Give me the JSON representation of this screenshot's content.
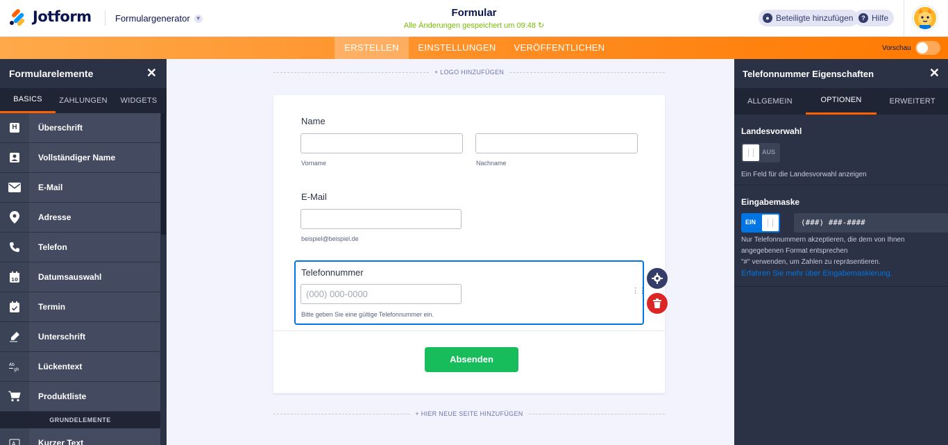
{
  "header": {
    "brand": "Jotform",
    "product": "Formulargenerator",
    "form_title": "Formular",
    "save_status": "Alle Änderungen gespeichert um 09:48",
    "invite_label": "Beteiligte hinzufügen",
    "help_label": "Hilfe"
  },
  "nav": {
    "tabs": [
      "ERSTELLEN",
      "EINSTELLUNGEN",
      "VERÖFFENTLICHEN"
    ],
    "active": 0,
    "preview_label": "Vorschau",
    "accent": "#ff7a00"
  },
  "left_panel": {
    "title": "Formularelemente",
    "tabs": [
      "BASICS",
      "ZAHLUNGEN",
      "WIDGETS"
    ],
    "items": [
      {
        "label": "Überschrift",
        "icon": "heading-icon"
      },
      {
        "label": "Vollständiger Name",
        "icon": "contact-card-icon"
      },
      {
        "label": "E-Mail",
        "icon": "envelope-icon"
      },
      {
        "label": "Adresse",
        "icon": "map-pin-icon"
      },
      {
        "label": "Telefon",
        "icon": "phone-icon"
      },
      {
        "label": "Datumsauswahl",
        "icon": "calendar-icon"
      },
      {
        "label": "Termin",
        "icon": "calendar-check-icon"
      },
      {
        "label": "Unterschrift",
        "icon": "signature-icon"
      },
      {
        "label": "Lückentext",
        "icon": "fill-blank-icon"
      },
      {
        "label": "Produktliste",
        "icon": "cart-icon"
      }
    ],
    "section_label": "GRUNDELEMENTE",
    "after_section": {
      "label": "Kurzer Text",
      "icon": "short-text-icon"
    }
  },
  "canvas": {
    "add_logo": "+ LOGO HINZUFÜGEN",
    "add_page": "+ HIER NEUE SEITE HINZUFÜGEN",
    "name": {
      "label": "Name",
      "first_sub": "Vorname",
      "last_sub": "Nachname"
    },
    "email": {
      "label": "E-Mail",
      "sub": "beispiel@beispiel.de"
    },
    "phone": {
      "label": "Telefonnummer",
      "placeholder": "(000) 000-0000",
      "sub": "Bitte geben Sie eine gültige Telefonnummer ein."
    },
    "submit_label": "Absenden"
  },
  "right_panel": {
    "title": "Telefonnummer Eigenschaften",
    "tabs": [
      "ALLGEMEIN",
      "OPTIONEN",
      "ERWEITERT"
    ],
    "country_code": {
      "title": "Landesvorwahl",
      "toggle_label": "AUS",
      "desc": "Ein Feld für die Landesvorwahl anzeigen"
    },
    "input_mask": {
      "title": "Eingabemaske",
      "toggle_label": "EIN",
      "mask_value": "(###) ###-####",
      "desc1": "Nur Telefonnummern akzeptieren, die dem von Ihnen angegebenen Format entsprechen",
      "desc2": "\"#\" verwenden, um Zahlen zu repräsentieren.",
      "link": "Erfahren Sie mehr über Eingabemaskierung."
    }
  }
}
